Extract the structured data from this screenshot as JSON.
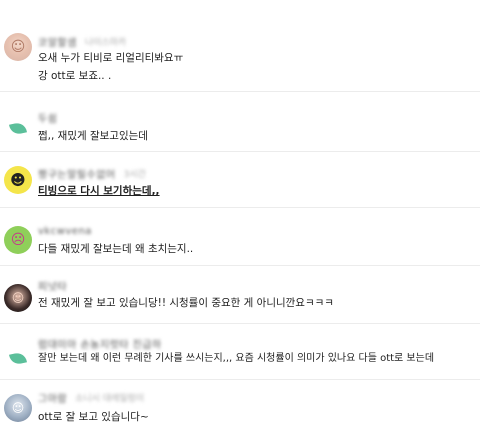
{
  "comments": [
    {
      "author": "코알할샘",
      "date": "나이스마카",
      "lines": [
        "오새 누가 티비로 리얼리티봐요ㅠ",
        "강 ott로 보죠.. ."
      ],
      "avatar": "avatar-photo",
      "bold": false
    },
    {
      "author": "두쉼",
      "date": "",
      "lines": [
        "쩝,, 재밌게 잘보고있는데"
      ],
      "avatar": "leaf-icon",
      "bold": false
    },
    {
      "author": "짱구는말릴수없어",
      "date": "3시간",
      "lines": [
        "티빙으로 다시 보기하는데,,"
      ],
      "avatar": "cartoon-avatar",
      "bold": true
    },
    {
      "author": "vkcwvena",
      "date": "",
      "lines": [
        "다들 재밌게 잘보는데 왜 초치는지.."
      ],
      "avatar": "cartoon-avatar",
      "bold": false
    },
    {
      "author": "피넛타",
      "date": "",
      "lines": [
        "전 재밌게 잘 보고 있습니당!! 시청률이 중요한 게 아니니깐요ㅋㅋㅋ"
      ],
      "avatar": "avatar-photo",
      "bold": false
    },
    {
      "author": "럼대미아 손농지럿타 진급하",
      "date": "",
      "lines": [
        "잘만 보는데 왜 이런 무례한 기사를 쓰시는지,,, 요즘 시청률이 의미가 있나요 다들 ott로 보는데"
      ],
      "avatar": "leaf-icon",
      "bold": false
    },
    {
      "author": "그아람",
      "date": "소니시 대레일렁이",
      "lines": [
        "ott로 잘 보고 있습니다~"
      ],
      "avatar": "avatar-photo",
      "bold": false
    }
  ]
}
